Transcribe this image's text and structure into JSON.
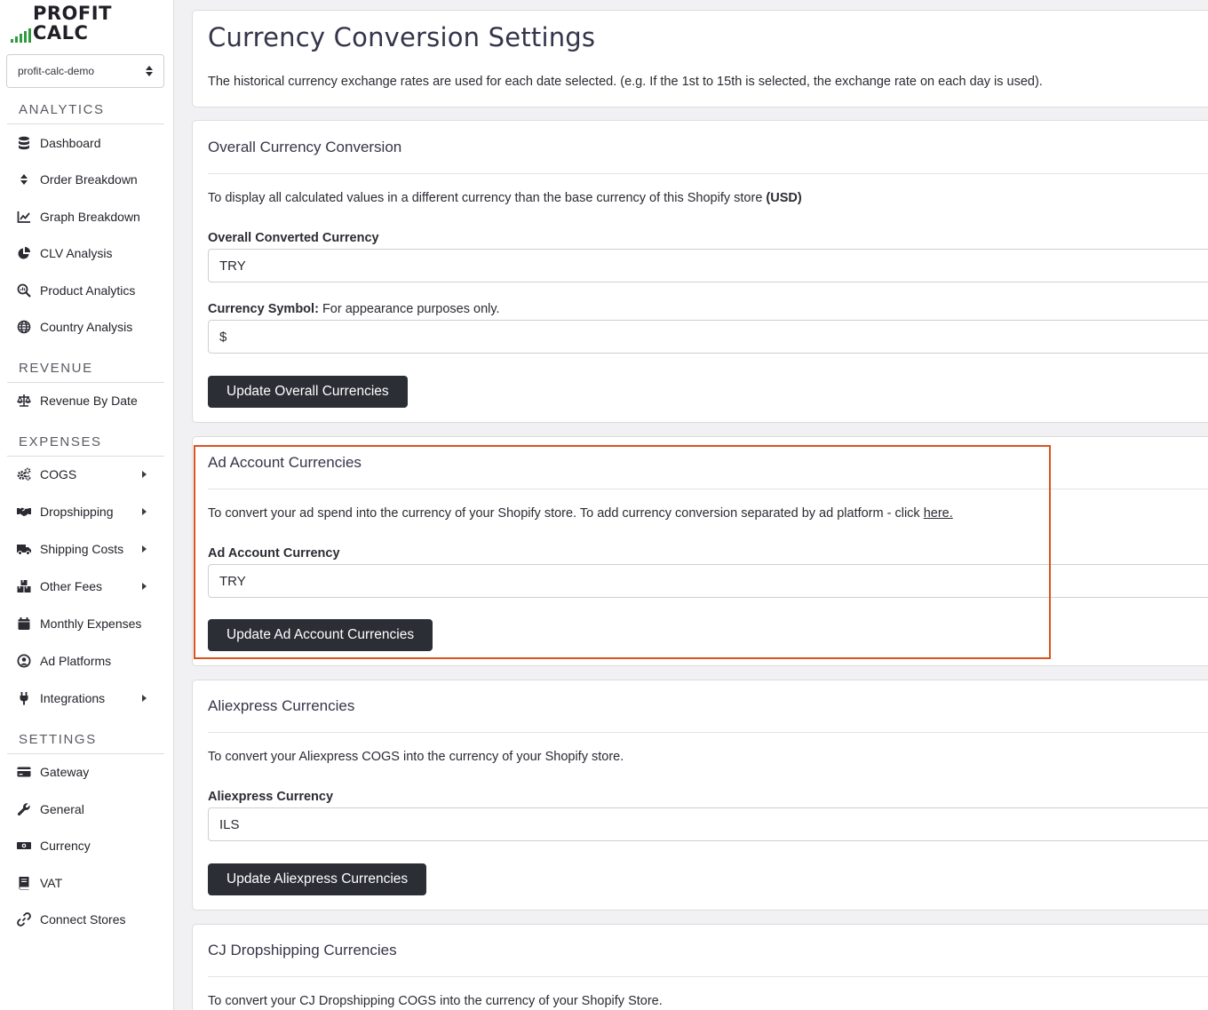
{
  "app": {
    "logo_text": "PROFIT CALC",
    "store_select": "profit-calc-demo"
  },
  "sidebar": {
    "sections": {
      "analytics": "ANALYTICS",
      "revenue": "REVENUE",
      "expenses": "EXPENSES",
      "settings": "SETTINGS"
    },
    "analytics_items": [
      {
        "label": "Dashboard",
        "icon": "database-icon"
      },
      {
        "label": "Order Breakdown",
        "icon": "sort-icon"
      },
      {
        "label": "Graph Breakdown",
        "icon": "line-chart-icon"
      },
      {
        "label": "CLV Analysis",
        "icon": "pie-chart-icon"
      },
      {
        "label": "Product Analytics",
        "icon": "magnify-chart-icon"
      },
      {
        "label": "Country Analysis",
        "icon": "globe-icon"
      }
    ],
    "revenue_items": [
      {
        "label": "Revenue By Date",
        "icon": "scale-icon"
      }
    ],
    "expenses_items": [
      {
        "label": "COGS",
        "icon": "cogs-icon",
        "submenu": true
      },
      {
        "label": "Dropshipping",
        "icon": "handshake-icon",
        "submenu": true
      },
      {
        "label": "Shipping Costs",
        "icon": "truck-icon",
        "submenu": true
      },
      {
        "label": "Other Fees",
        "icon": "boxes-icon",
        "submenu": true
      },
      {
        "label": "Monthly Expenses",
        "icon": "calendar-icon",
        "submenu": false
      },
      {
        "label": "Ad Platforms",
        "icon": "user-circle-icon",
        "submenu": false
      },
      {
        "label": "Integrations",
        "icon": "plug-icon",
        "submenu": true
      }
    ],
    "settings_items": [
      {
        "label": "Gateway",
        "icon": "credit-card-icon"
      },
      {
        "label": "General",
        "icon": "wrench-icon"
      },
      {
        "label": "Currency",
        "icon": "money-bill-icon"
      },
      {
        "label": "VAT",
        "icon": "book-icon"
      },
      {
        "label": "Connect Stores",
        "icon": "link-icon"
      }
    ]
  },
  "header_card": {
    "title": "Currency Conversion Settings",
    "description": "The historical currency exchange rates are used for each date selected. (e.g. If the 1st to 15th is selected, the exchange rate on each day is used)."
  },
  "overall": {
    "title": "Overall Currency Conversion",
    "description": "To display all calculated values in a different currency than the base currency of this Shopify store",
    "base_currency": "(USD)",
    "currency_label": "Overall Converted Currency",
    "currency_value": "TRY",
    "symbol_label_bold": "Currency Symbol:",
    "symbol_label_rest": "For appearance purposes only.",
    "symbol_value": "$",
    "button": "Update Overall Currencies"
  },
  "ad_account": {
    "title": "Ad Account Currencies",
    "description": "To convert your ad spend into the currency of your Shopify store. To add currency conversion separated by ad platform - click",
    "link_text": "here.",
    "currency_label": "Ad Account Currency",
    "currency_value": "TRY",
    "button": "Update Ad Account Currencies",
    "highlight_color": "#d9531e"
  },
  "aliexpress": {
    "title": "Aliexpress Currencies",
    "description": "To convert your Aliexpress COGS into the currency of your Shopify store.",
    "currency_label": "Aliexpress Currency",
    "currency_value": "ILS",
    "button": "Update Aliexpress Currencies"
  },
  "cj": {
    "title": "CJ Dropshipping Currencies",
    "description": "To convert your CJ Dropshipping COGS into the currency of your Shopify Store."
  },
  "colors": {
    "button_bg": "#2b2e35",
    "logo_green": "#2e9b3e"
  }
}
